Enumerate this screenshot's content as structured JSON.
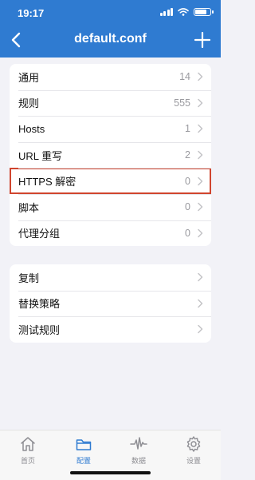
{
  "status_bar": {
    "time": "19:17"
  },
  "nav": {
    "title": "default.conf"
  },
  "group1": [
    {
      "label": "通用",
      "count": "14"
    },
    {
      "label": "规则",
      "count": "555"
    },
    {
      "label": "Hosts",
      "count": "1"
    },
    {
      "label": "URL 重写",
      "count": "2"
    },
    {
      "label": "HTTPS 解密",
      "count": "0"
    },
    {
      "label": "脚本",
      "count": "0"
    },
    {
      "label": "代理分组",
      "count": "0"
    }
  ],
  "group2": [
    {
      "label": "复制"
    },
    {
      "label": "替换策略"
    },
    {
      "label": "测试规则"
    }
  ],
  "tabs": [
    {
      "label": "首页",
      "icon": "home-icon"
    },
    {
      "label": "配置",
      "icon": "folder-icon"
    },
    {
      "label": "数据",
      "icon": "waveform-icon"
    },
    {
      "label": "设置",
      "icon": "gear-icon"
    }
  ],
  "colors": {
    "accent": "#2f7bd1",
    "highlight": "#d0452e"
  }
}
